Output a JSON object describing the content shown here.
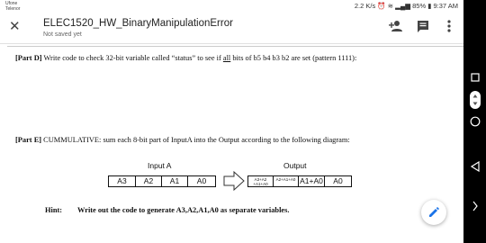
{
  "status_bar": {
    "carrier_line1": "Ufone",
    "carrier_line2": "Telenor",
    "network_speed": "2.2 K/s",
    "battery": "85%",
    "time": "9:37 AM"
  },
  "app_bar": {
    "title": "ELEC1520_HW_BinaryManipulationError",
    "save_status": "Not saved yet",
    "close_icon": "close-icon",
    "icons": [
      "person-add-icon",
      "comment-icon",
      "more-vert-icon"
    ]
  },
  "document": {
    "part_d": {
      "label": "[Part D]",
      "text_before": " Write code to check 32-bit variable called “status” to see if ",
      "underlined": "all",
      "text_after": " bits of b5 b4 b3 b2 are set (pattern 1111):"
    },
    "part_e": {
      "label": "[Part E]",
      "text": " CUMMULATIVE: sum each 8-bit part of InputA into the Output according to the following diagram:"
    },
    "diagram": {
      "input_label": "Input A",
      "input_cells": [
        "A3",
        "A2",
        "A1",
        "A0"
      ],
      "output_label": "Output",
      "output_cells": [
        {
          "line1": "A3+A2",
          "line2": "+A1+A0"
        },
        {
          "line1": "A2+A1+A0",
          "line2": ""
        },
        {
          "line1": "A1+A0",
          "line2": ""
        },
        {
          "line1": "A0",
          "line2": ""
        }
      ]
    },
    "hint": {
      "label": "Hint:",
      "text": "Write out the code to generate A3,A2,A1,A0 as separate variables."
    }
  },
  "fab_icon": "edit-icon",
  "nav_bar": [
    "square-icon",
    "scroll-icon",
    "circle-icon",
    "back-triangle-icon",
    "chevron-right-icon"
  ]
}
